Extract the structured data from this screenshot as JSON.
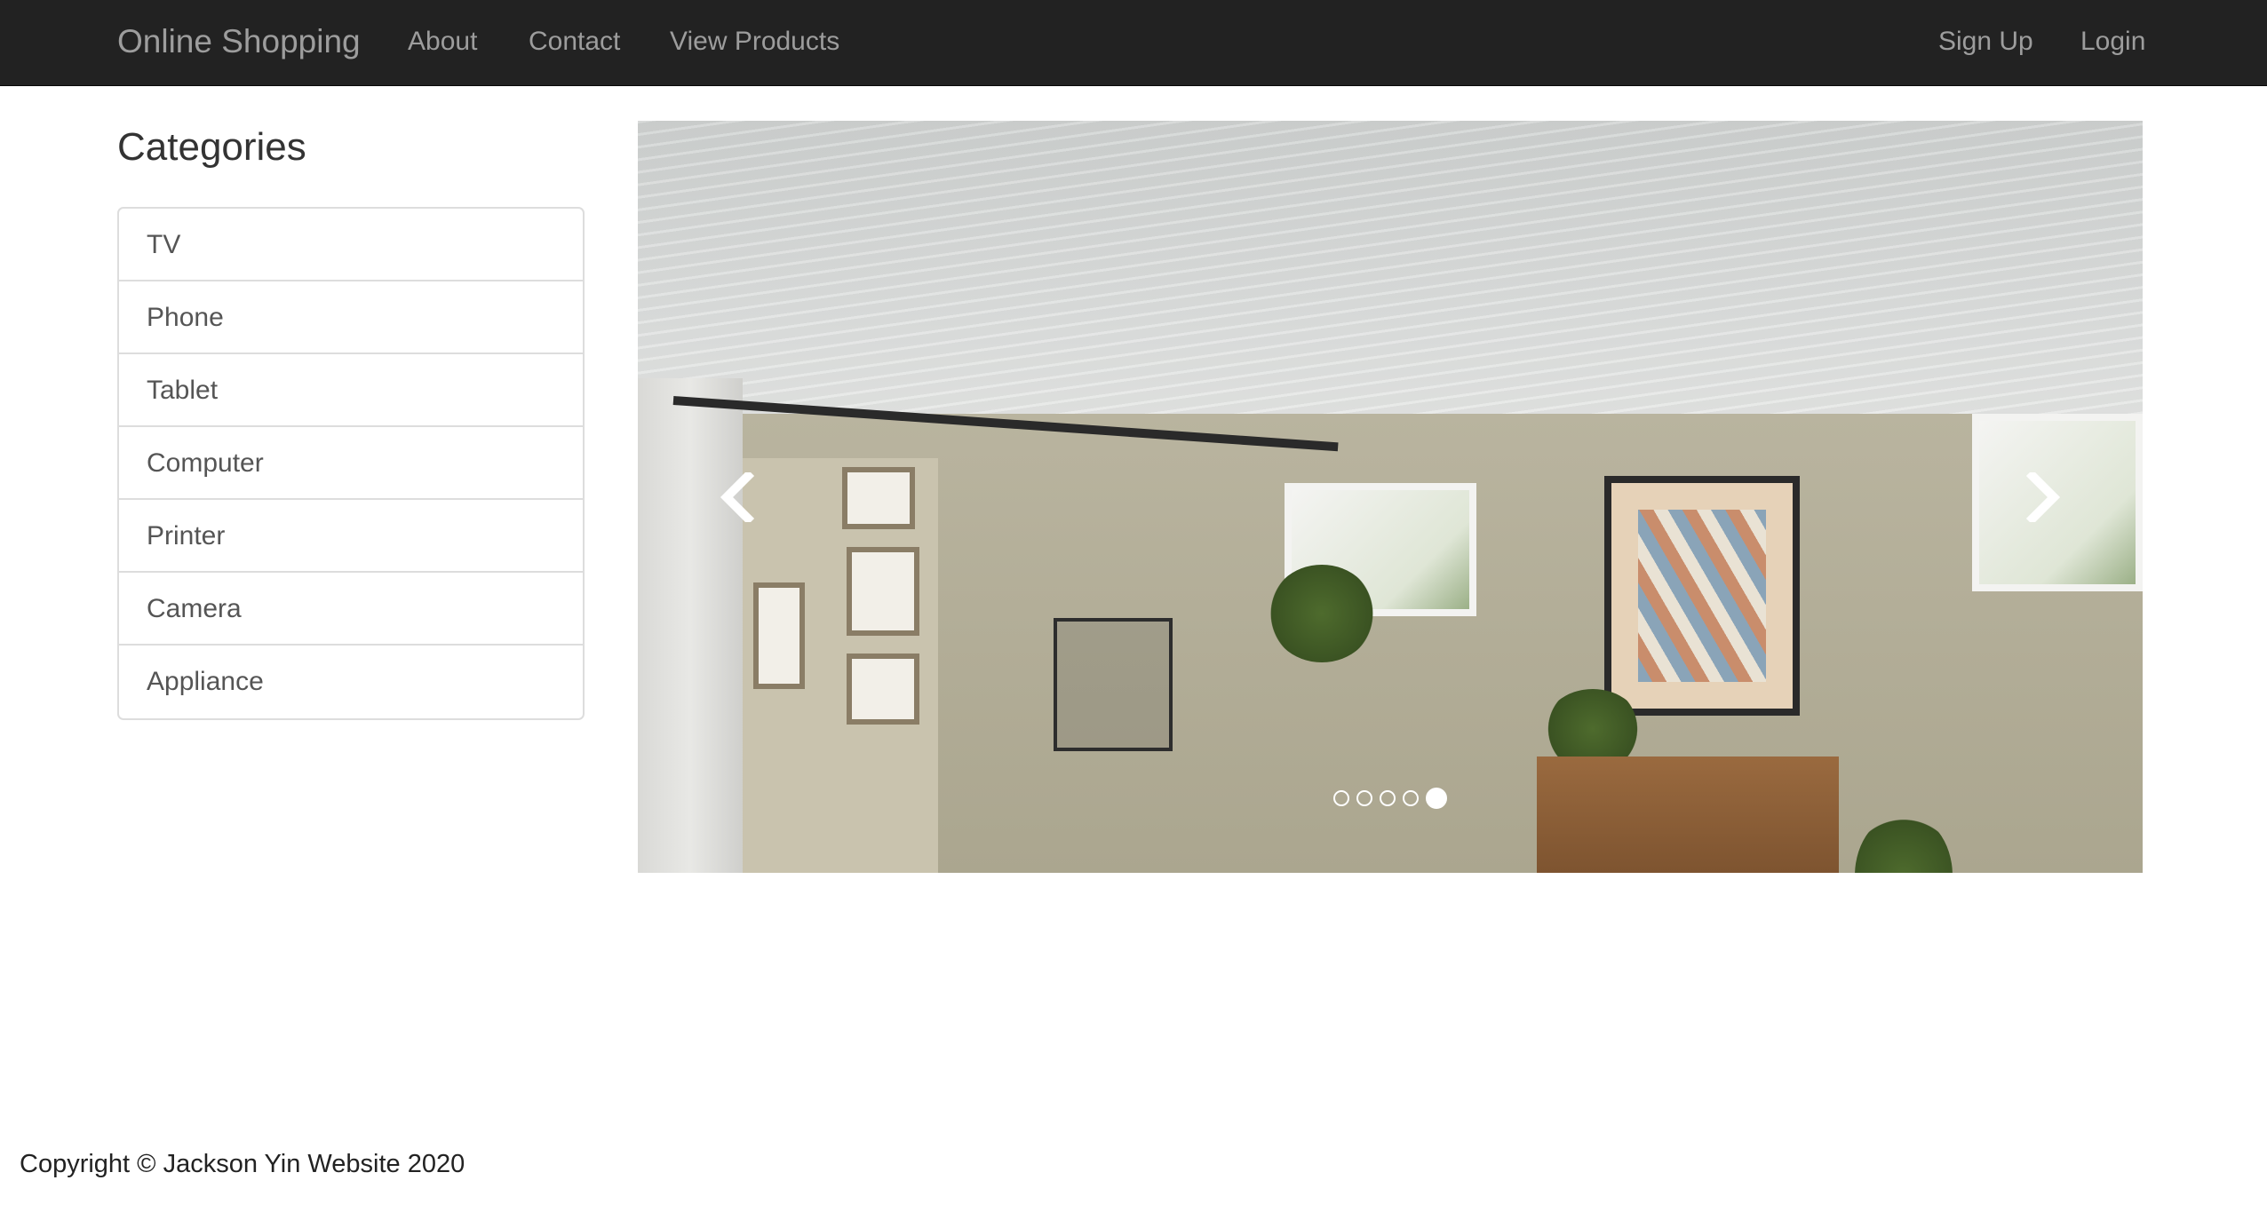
{
  "navbar": {
    "brand": "Online Shopping",
    "links": [
      "About",
      "Contact",
      "View Products"
    ],
    "right_links": [
      "Sign Up",
      "Login"
    ]
  },
  "sidebar": {
    "title": "Categories",
    "items": [
      "TV",
      "Phone",
      "Tablet",
      "Computer",
      "Printer",
      "Camera",
      "Appliance"
    ]
  },
  "carousel": {
    "slide_count": 5,
    "active_index": 4,
    "prev_icon": "chevron-left-icon",
    "next_icon": "chevron-right-icon"
  },
  "footer": {
    "copyright": "Copyright © Jackson Yin Website 2020"
  }
}
